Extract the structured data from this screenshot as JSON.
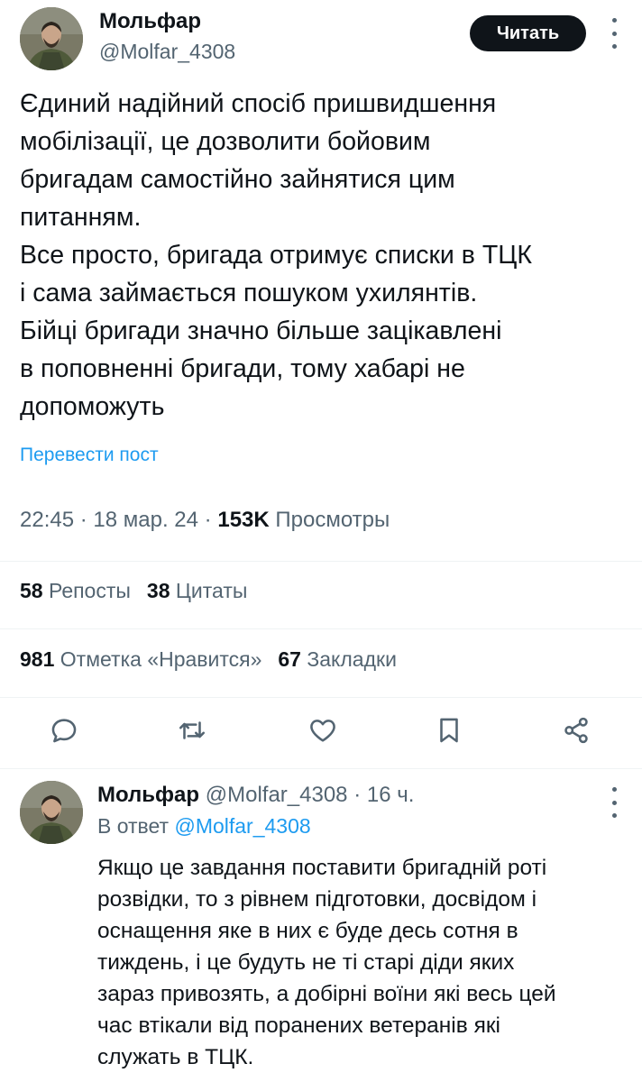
{
  "tweet": {
    "author_name": "Мольфар",
    "author_handle": "@Molfar_4308",
    "follow_label": "Читать",
    "body_lines": [
      "Єдиний надійний спосіб пришвидшення",
      "мобілізації, це дозволити бойовим",
      "бригадам самостійно зайнятися цим",
      "питанням.",
      "Все просто, бригада отримує списки в ТЦК",
      "і сама займається пошуком ухилянтів.",
      "Бійці бригади значно більше зацікавлені",
      "в поповненні бригади, тому хабарі не",
      "допоможуть"
    ],
    "translate_label": "Перевести пост",
    "time": "22:45",
    "date": "18 мар. 24",
    "views_count": "153K",
    "views_label": "Просмотры",
    "reposts_count": "58",
    "reposts_label": "Репосты",
    "quotes_count": "38",
    "quotes_label": "Цитаты",
    "likes_count": "981",
    "likes_label": "Отметка «Нравится»",
    "bookmarks_count": "67",
    "bookmarks_label": "Закладки"
  },
  "actions": {
    "icons": [
      "reply-icon",
      "retweet-icon",
      "like-icon",
      "bookmark-icon",
      "share-icon"
    ]
  },
  "reply": {
    "author_name": "Мольфар",
    "author_handle": "@Molfar_4308",
    "age": "16 ч.",
    "in_reply_prefix": "В ответ",
    "in_reply_handle": "@Molfar_4308",
    "body_lines": [
      "Якщо це завдання поставити бригадній роті",
      "розвідки, то з рівнем підготовки, досвідом і",
      "оснащення яке в них є буде десь сотня в",
      "тиждень, і це будуть не ті старі діди яких",
      "зараз привозять, а добірні воїни які весь цей",
      "час втікали від поранених ветеранів які",
      "служать в ТЦК."
    ]
  },
  "colors": {
    "text": "#0f1419",
    "secondary": "#536471",
    "link": "#1d9bf0",
    "divider": "#eff3f4"
  }
}
